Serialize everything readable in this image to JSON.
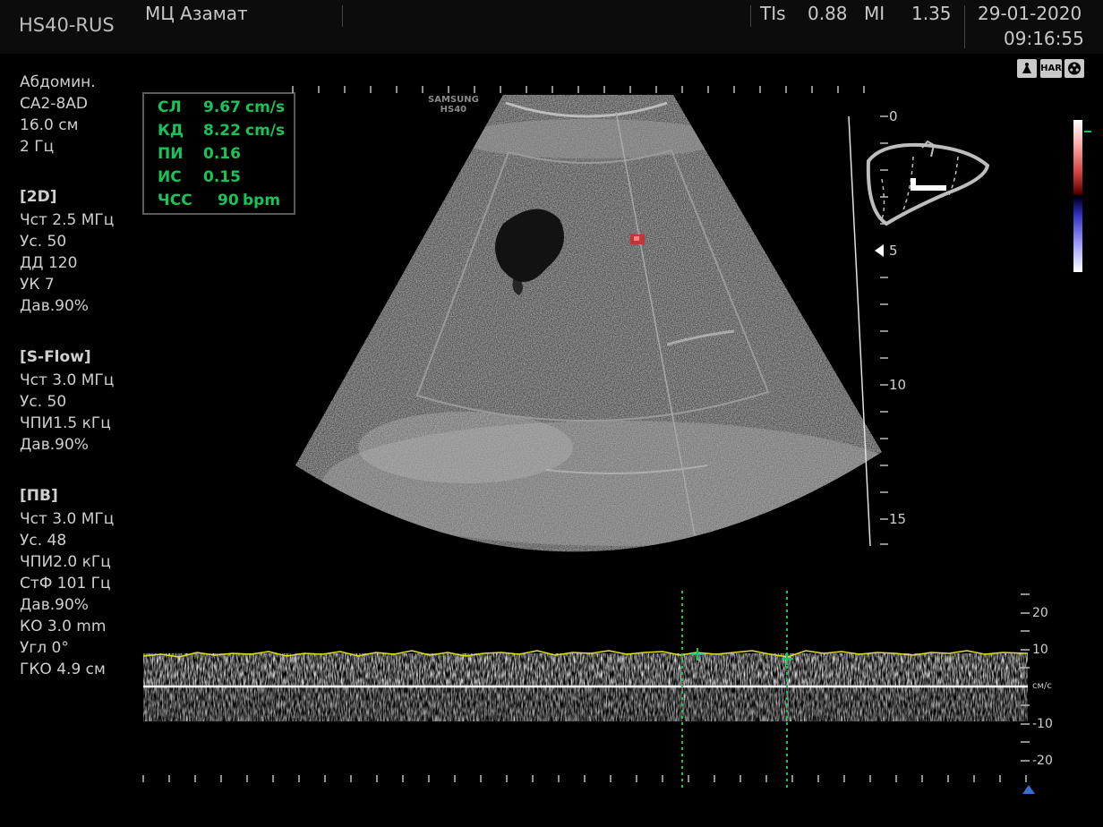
{
  "header": {
    "model": "HS40-RUS",
    "clinic": "МЦ Азамат",
    "tis_label": "TIs",
    "tis_value": "0.88",
    "mi_label": "MI",
    "mi_value": "1.35",
    "date": "29-01-2020",
    "time": "09:16:55"
  },
  "left_panel": {
    "general": [
      "Абдомин.",
      "CA2-8AD",
      "16.0 см",
      "2 Гц"
    ],
    "mode_2d": {
      "title": "[2D]",
      "lines": [
        "Чст  2.5 МГц",
        "Ус.   50",
        "ДД   120",
        "УК   7",
        "Дав.90%"
      ]
    },
    "mode_sflow": {
      "title": "[S-Flow]",
      "lines": [
        "Чст  3.0 МГц",
        "Ус.   50",
        "ЧПИ1.5 кГц",
        "Дав.90%"
      ]
    },
    "mode_pw": {
      "title": "[ПВ]",
      "lines": [
        "Чст  3.0 МГц",
        "Ус.   48",
        "ЧПИ2.0 кГц",
        "СтФ 101 Гц",
        "Дав.90%",
        "КО   3.0 mm",
        "Угл  0°",
        "ГКО 4.9 см"
      ]
    }
  },
  "measurements": [
    {
      "label": "СЛ",
      "value": "9.67",
      "unit": "cm/s"
    },
    {
      "label": "КД",
      "value": "8.22",
      "unit": "cm/s"
    },
    {
      "label": "ПИ",
      "value": "0.16",
      "unit": ""
    },
    {
      "label": "ИС",
      "value": "0.15",
      "unit": ""
    },
    {
      "label": "ЧСС",
      "value": "90",
      "unit": "bpm"
    }
  ],
  "watermark": {
    "line1": "SAMSUNG",
    "line2": "HS40"
  },
  "icons": {
    "probe": "probe-icon",
    "har": "HAR",
    "reel": "reel-icon"
  },
  "depth_scale": {
    "labels": [
      "0",
      "5",
      "10",
      "15"
    ]
  },
  "velocity_scale": {
    "labels": [
      "20",
      "10",
      "см/с",
      "-10",
      "-20"
    ]
  },
  "colors": {
    "measure": "#19c35a",
    "caliper": "#19c35a",
    "envelope": "#e0e020",
    "marker": "#3a6fd0"
  }
}
